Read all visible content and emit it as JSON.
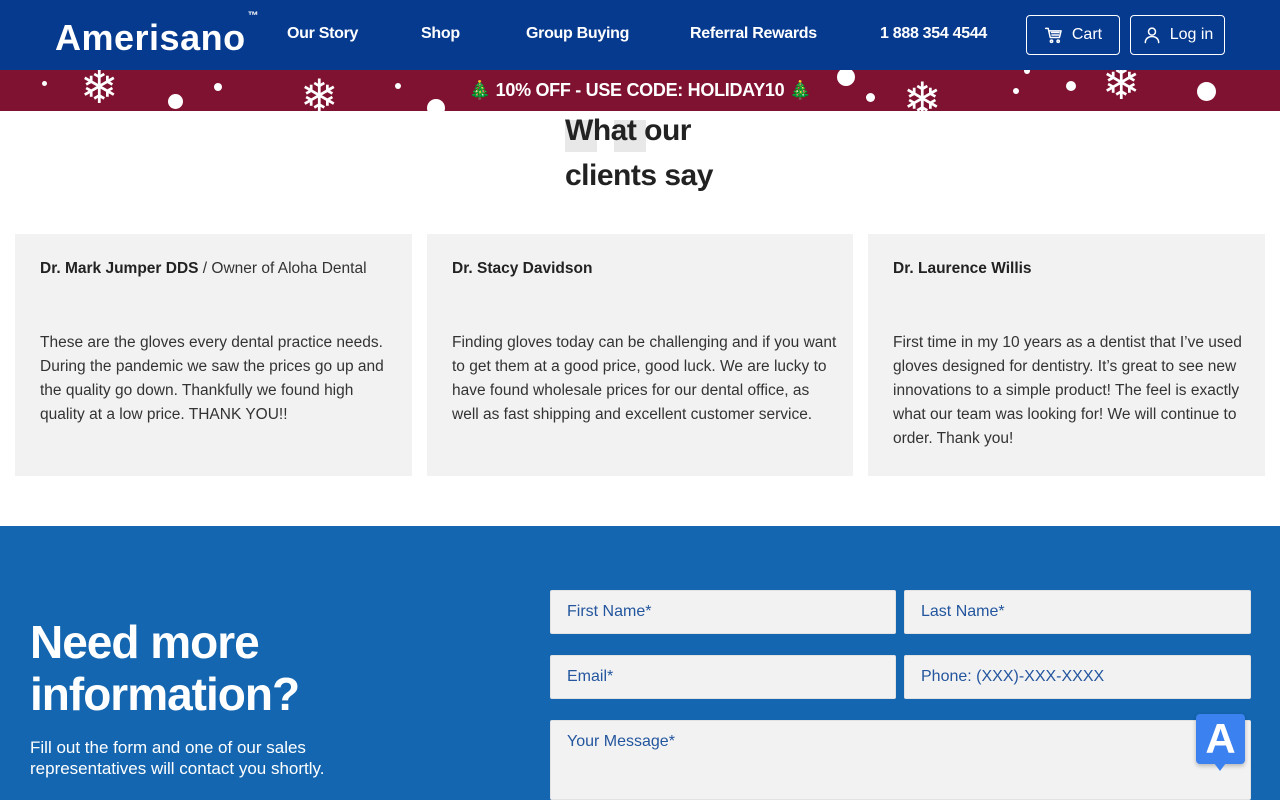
{
  "header": {
    "logo": "Amerisano",
    "logo_mark": "™",
    "nav": [
      "Our Story",
      "Shop",
      "Group Buying",
      "Referral Rewards",
      "1 888 354 4544"
    ],
    "cart_label": "Cart",
    "cart_icon": "cart-icon",
    "login_label": "Log in",
    "login_icon": "user-icon"
  },
  "promo": {
    "text": "🎄 10% OFF - USE CODE: HOLIDAY10 🎄",
    "background": "#7e1230"
  },
  "testimonials": {
    "title_line1": "What our",
    "title_line2": "clients say",
    "items": [
      {
        "name": "Dr. Mark Jumper DDS",
        "separator": " / ",
        "role": "Owner of Aloha Dental",
        "quote": "These are the gloves every dental practice needs. During the pandemic we saw the prices go up and the quality go down. Thankfully we found high quality at a low price. THANK YOU!!"
      },
      {
        "name": "Dr. Stacy Davidson",
        "separator": "",
        "role": "",
        "quote": "Finding gloves today can be challenging and if you want to get them at a good price, good luck. We are lucky to have found wholesale prices for our dental office, as well as fast shipping and excellent customer service."
      },
      {
        "name": "Dr. Laurence Willis",
        "separator": "",
        "role": "",
        "quote": "First time in my 10 years as a dentist that I’ve used gloves designed for dentistry. It’s great to see new innovations to a simple product! The feel is exactly what our team was looking for! We will continue to order. Thank you!"
      }
    ]
  },
  "contact": {
    "heading_line1": "Need more",
    "heading_line2": "information?",
    "description": "Fill out the form and one of our sales representatives will contact you shortly.",
    "fields": {
      "first_name": "First Name*",
      "last_name": "Last Name*",
      "email": "Email*",
      "phone": "Phone: (XXX)-XXX-XXXX",
      "message": "Your Message*"
    },
    "background": "#1466b0"
  },
  "widget": {
    "label": "A"
  }
}
